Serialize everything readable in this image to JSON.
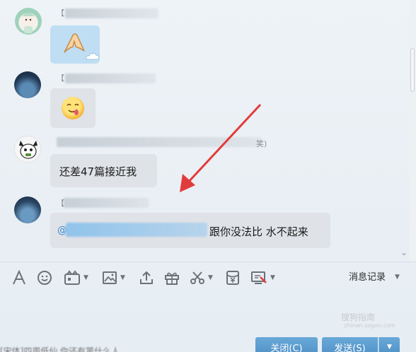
{
  "messages": [
    {
      "name_prefix": "【",
      "content_type": "sticker",
      "sticker": "pinching-hand-sticker"
    },
    {
      "name_prefix": "【",
      "content_type": "sticker",
      "sticker": "drooling-face-sticker"
    },
    {
      "name_prefix": "",
      "name_suffix": "笑)",
      "content_type": "text",
      "text": "还差47篇接近我"
    },
    {
      "name_prefix": "【",
      "content_type": "text",
      "text": "跟你没法比  水不起来",
      "mention": "@"
    }
  ],
  "toolbar": {
    "items": [
      "font-icon",
      "emoji-icon",
      "gif-icon",
      "image-icon",
      "upload-icon",
      "gift-icon",
      "scissors-icon",
      "red-packet-icon",
      "screen-record-icon"
    ],
    "history_label": "消息记录"
  },
  "input": {
    "hint_text": "[宋体]四周低仙 你还有第什么人"
  },
  "buttons": {
    "close_label": "关闭(C)",
    "send_label": "发送(S)"
  },
  "watermark": {
    "text": "搜狗指南",
    "sub": "zhinan.sogou.com"
  },
  "colors": {
    "accent_button": "#5a9bd0",
    "bubble_gray": "#dfe2e7",
    "bubble_blue": "#bfdef3",
    "arrow_red": "#e23b3b"
  }
}
